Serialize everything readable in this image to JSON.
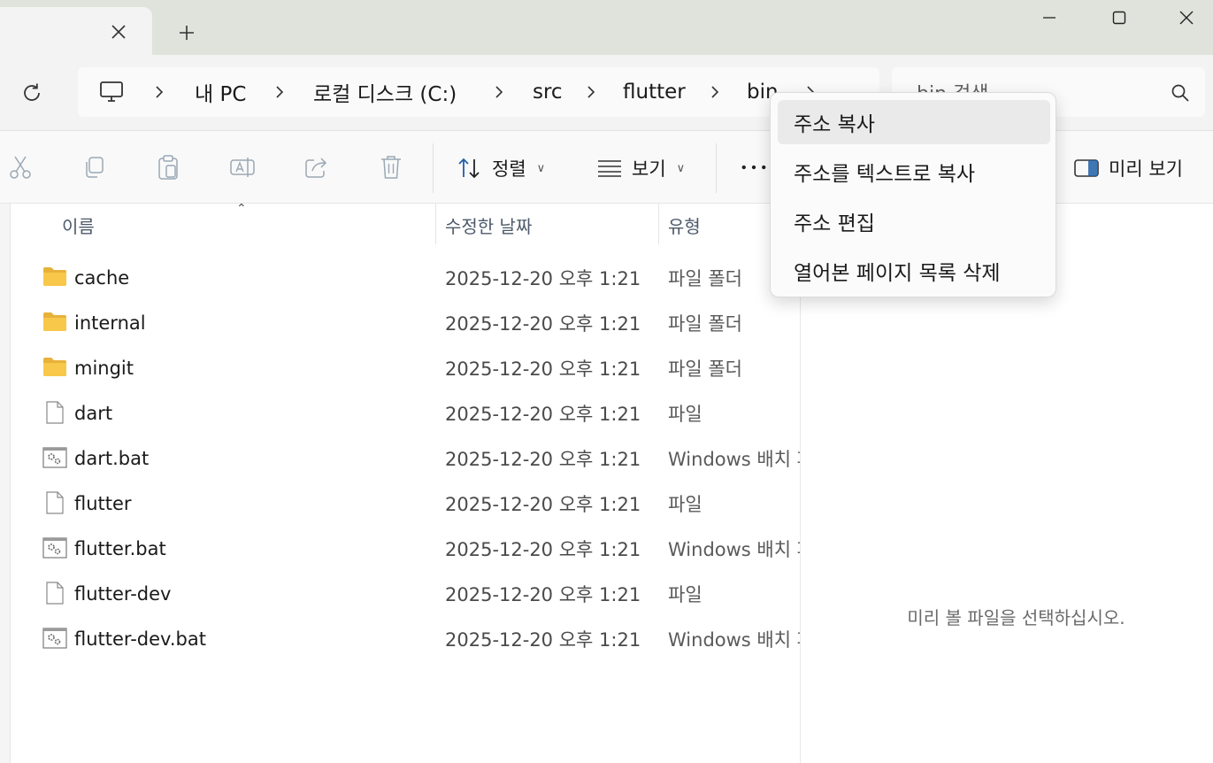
{
  "window": {
    "tab_close_icon": "close-icon",
    "new_tab_icon": "plus-icon",
    "controls": [
      "minimize-icon",
      "maximize-icon",
      "close-icon"
    ]
  },
  "address": {
    "refresh_icon": "refresh-icon",
    "pc_icon": "monitor-icon",
    "crumbs": [
      "내 PC",
      "로컬 디스크 (C:)",
      "src",
      "flutter",
      "bin"
    ],
    "search_placeholder": "bin 검색"
  },
  "toolbar": {
    "cut_icon": "scissors-icon",
    "copy_icon": "copy-icon",
    "paste_icon": "paste-icon",
    "rename_icon": "rename-icon",
    "share_icon": "share-icon",
    "delete_icon": "trash-icon",
    "sort_label": "정렬",
    "view_label": "보기",
    "more_icon": "more-icon",
    "preview_label": "미리 보기"
  },
  "columns": {
    "name": "이름",
    "modified": "수정한 날짜",
    "type": "유형"
  },
  "files": [
    {
      "name": "cache",
      "date": "2025-12-20 오후 1:21",
      "type": "파일 폴더",
      "icon": "folder-icon"
    },
    {
      "name": "internal",
      "date": "2025-12-20 오후 1:21",
      "type": "파일 폴더",
      "icon": "folder-icon"
    },
    {
      "name": "mingit",
      "date": "2025-12-20 오후 1:21",
      "type": "파일 폴더",
      "icon": "folder-icon"
    },
    {
      "name": "dart",
      "date": "2025-12-20 오후 1:21",
      "type": "파일",
      "icon": "file-icon"
    },
    {
      "name": "dart.bat",
      "date": "2025-12-20 오후 1:21",
      "type": "Windows 배치 파일",
      "icon": "batch-file-icon"
    },
    {
      "name": "flutter",
      "date": "2025-12-20 오후 1:21",
      "type": "파일",
      "icon": "file-icon"
    },
    {
      "name": "flutter.bat",
      "date": "2025-12-20 오후 1:21",
      "type": "Windows 배치 파일",
      "icon": "batch-file-icon"
    },
    {
      "name": "flutter-dev",
      "date": "2025-12-20 오후 1:21",
      "type": "파일",
      "icon": "file-icon"
    },
    {
      "name": "flutter-dev.bat",
      "date": "2025-12-20 오후 1:21",
      "type": "Windows 배치 파일",
      "icon": "batch-file-icon"
    }
  ],
  "preview": {
    "message": "미리 볼 파일을 선택하십시오."
  },
  "context_menu": {
    "items": [
      "주소 복사",
      "주소를 텍스트로 복사",
      "주소 편집",
      "열어본 페이지 목록 삭제"
    ]
  },
  "colors": {
    "tabstrip_bg": "#dfe3dc",
    "folder_yellow": "#f8c84a",
    "accent_blue": "#1f5fa8"
  }
}
